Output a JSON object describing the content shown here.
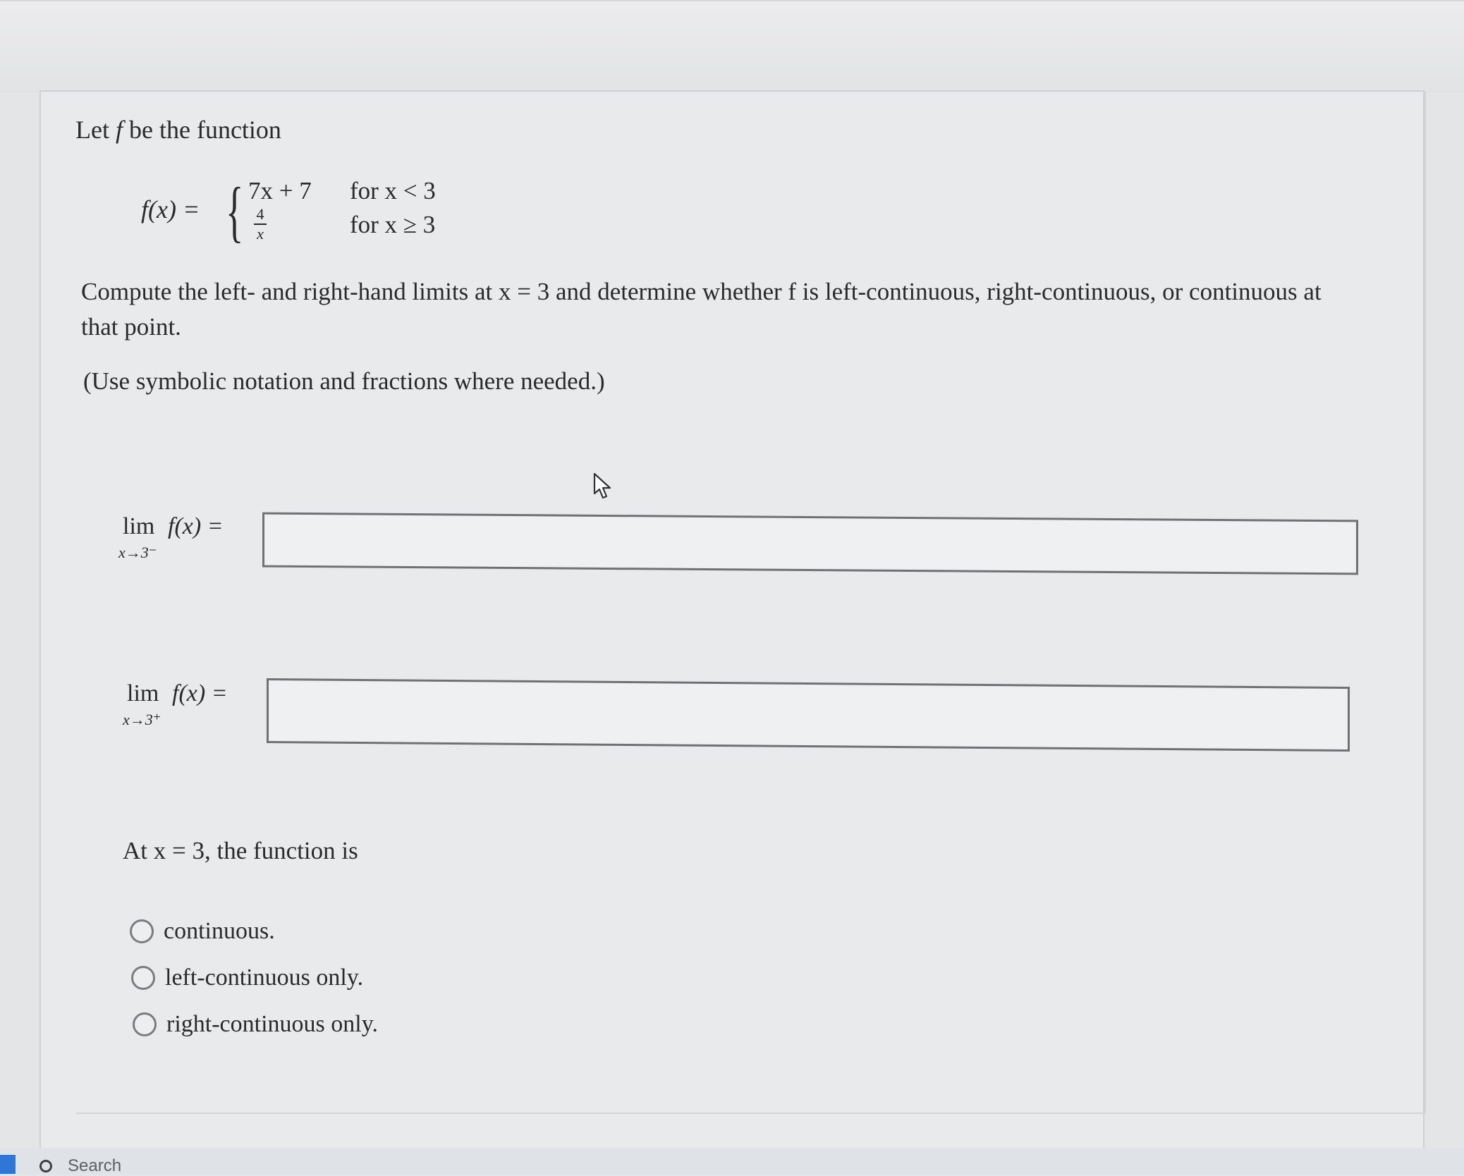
{
  "problem": {
    "intro_prefix": "Let ",
    "intro_var": "f",
    "intro_suffix": " be the function",
    "fx_label": "f(x) =",
    "piece1_expr": "7x + 7",
    "piece1_cond": "for x < 3",
    "piece2_num": "4",
    "piece2_den": "x",
    "piece2_cond": "for x ≥ 3",
    "question_line1": "Compute the left- and right-hand limits at x = 3 and determine whether f is left-continuous, right-continuous, or continuous at",
    "question_line2": "that point.",
    "hint": "(Use symbolic notation and fractions where needed.)"
  },
  "limits": {
    "left": {
      "lim_word": "lim",
      "expr": "f(x) =",
      "sub": "x→3⁻",
      "value": ""
    },
    "right": {
      "lim_word": "lim",
      "expr": "f(x) =",
      "sub": "x→3⁺",
      "value": ""
    }
  },
  "continuity": {
    "prompt": "At x = 3, the function is",
    "options": [
      "continuous.",
      "left-continuous only.",
      "right-continuous only."
    ]
  },
  "taskbar": {
    "search_label": "Search"
  },
  "icons": {
    "cursor": "cursor-arrow-icon",
    "search": "search-icon",
    "radio": "radio-circle-icon"
  }
}
